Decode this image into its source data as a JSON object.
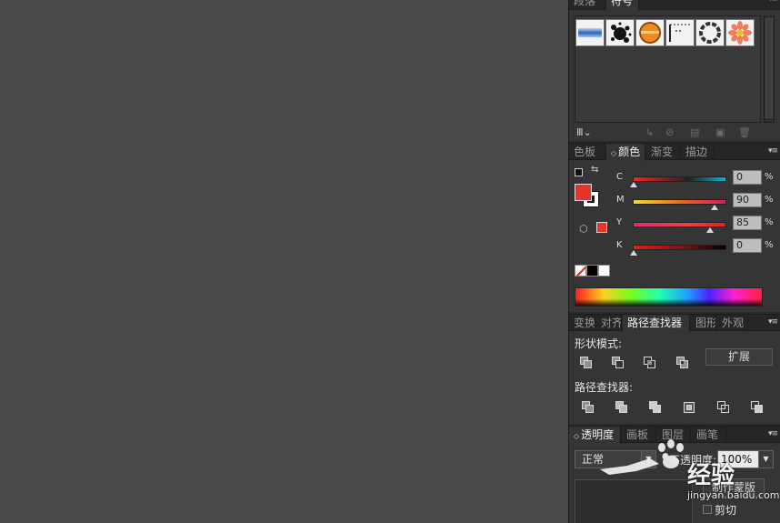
{
  "symbols_panel": {
    "tabs": [
      "段落",
      "符号"
    ],
    "active_tab": "符号",
    "menu_icon": "panel-menu-icon",
    "items": [
      "blue-banner-symbol",
      "ink-splat-symbol",
      "orange-button-symbol",
      "dotted-line-symbol",
      "ring-wreath-symbol",
      "flower-symbol"
    ],
    "footer_icons": [
      "symbol-library-icon",
      "place-symbol-icon",
      "break-link-icon",
      "symbol-options-icon",
      "new-symbol-icon",
      "delete-icon"
    ]
  },
  "color_panel": {
    "tabs": [
      "色板",
      "颜色",
      "渐变",
      "描边"
    ],
    "active_tab": "颜色",
    "channels": [
      {
        "label": "C",
        "value": "0",
        "pos": 0.0
      },
      {
        "label": "M",
        "value": "90",
        "pos": 0.9
      },
      {
        "label": "Y",
        "value": "85",
        "pos": 0.85
      },
      {
        "label": "K",
        "value": "0",
        "pos": 0.0
      }
    ],
    "percent": "%",
    "fill_color": "#e8322a",
    "stroke_color": "#ffffff"
  },
  "pathfinder_panel": {
    "tabs": [
      "变换",
      "对齐",
      "路径查找器",
      "图形",
      "外观"
    ],
    "active_tab": "路径查找器",
    "shape_modes_label": "形状模式:",
    "expand_label": "扩展",
    "pathfinders_label": "路径查找器:"
  },
  "transparency_panel": {
    "tabs": [
      "透明度",
      "画板",
      "图层",
      "画笔"
    ],
    "active_tab": "透明度",
    "blend_mode": "正常",
    "opacity_label": "不透明度:",
    "opacity_value": "100%",
    "make_mask_label": "制作蒙版",
    "clip_label": "剪切",
    "watermark": "经验",
    "watermark_url": "jingyan.baidu.com"
  }
}
